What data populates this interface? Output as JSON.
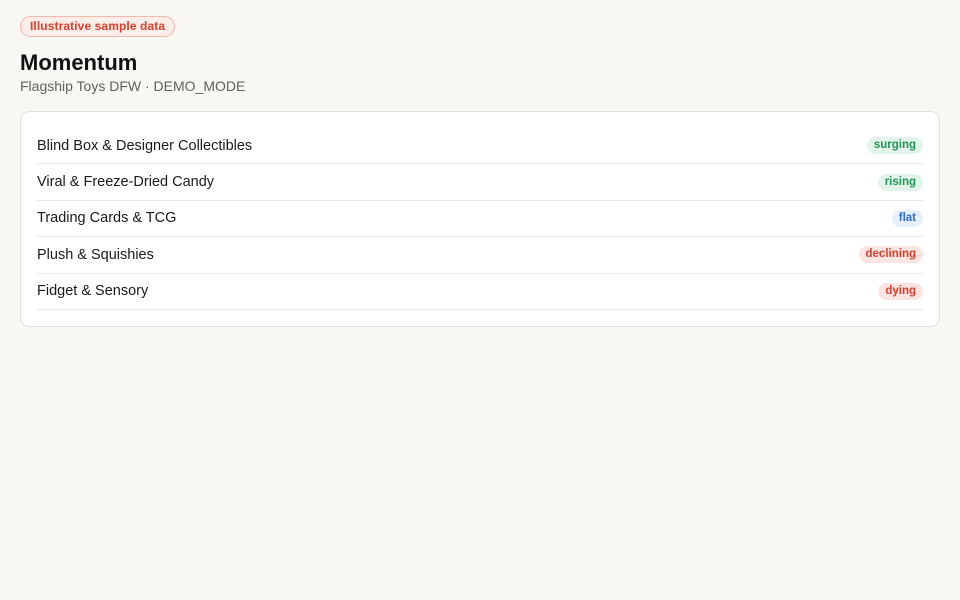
{
  "badge": {
    "label": "Illustrative sample data"
  },
  "header": {
    "title": "Momentum",
    "subtitle": "Flagship Toys DFW · DEMO_MODE"
  },
  "categories": [
    {
      "name": "Blind Box & Designer Collectibles",
      "trend": "surging"
    },
    {
      "name": "Viral & Freeze-Dried Candy",
      "trend": "rising"
    },
    {
      "name": "Trading Cards & TCG",
      "trend": "flat"
    },
    {
      "name": "Plush & Squishies",
      "trend": "declining"
    },
    {
      "name": "Fidget & Sensory",
      "trend": "dying"
    }
  ],
  "colors": {
    "positive": "#1f9557",
    "neutral": "#2f6fd6",
    "negative": "#d9402b"
  }
}
